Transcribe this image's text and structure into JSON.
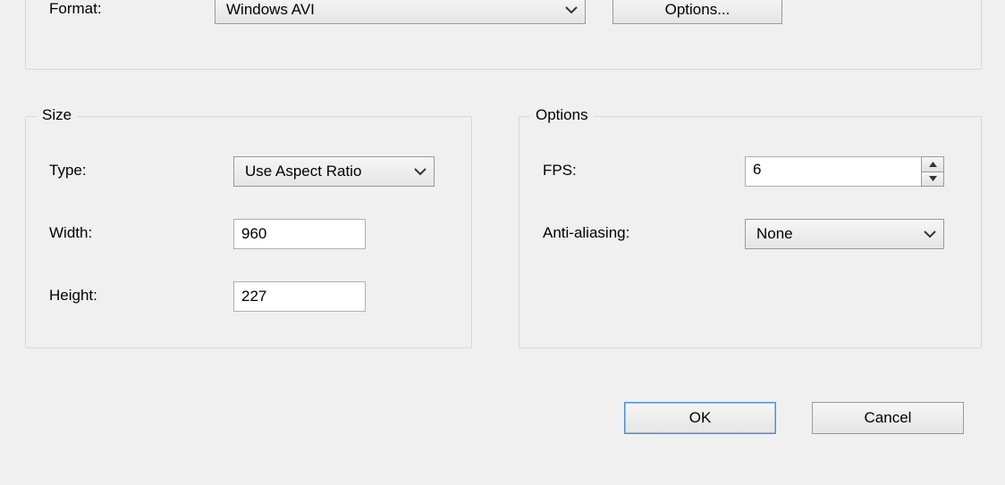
{
  "format": {
    "label": "Format:",
    "selected": "Windows AVI",
    "options_button": "Options..."
  },
  "size": {
    "legend": "Size",
    "type_label": "Type:",
    "type_selected": "Use Aspect Ratio",
    "width_label": "Width:",
    "width_value": "960",
    "height_label": "Height:",
    "height_value": "227"
  },
  "options": {
    "legend": "Options",
    "fps_label": "FPS:",
    "fps_value": "6",
    "aa_label": "Anti-aliasing:",
    "aa_selected": "None"
  },
  "buttons": {
    "ok": "OK",
    "cancel": "Cancel"
  }
}
